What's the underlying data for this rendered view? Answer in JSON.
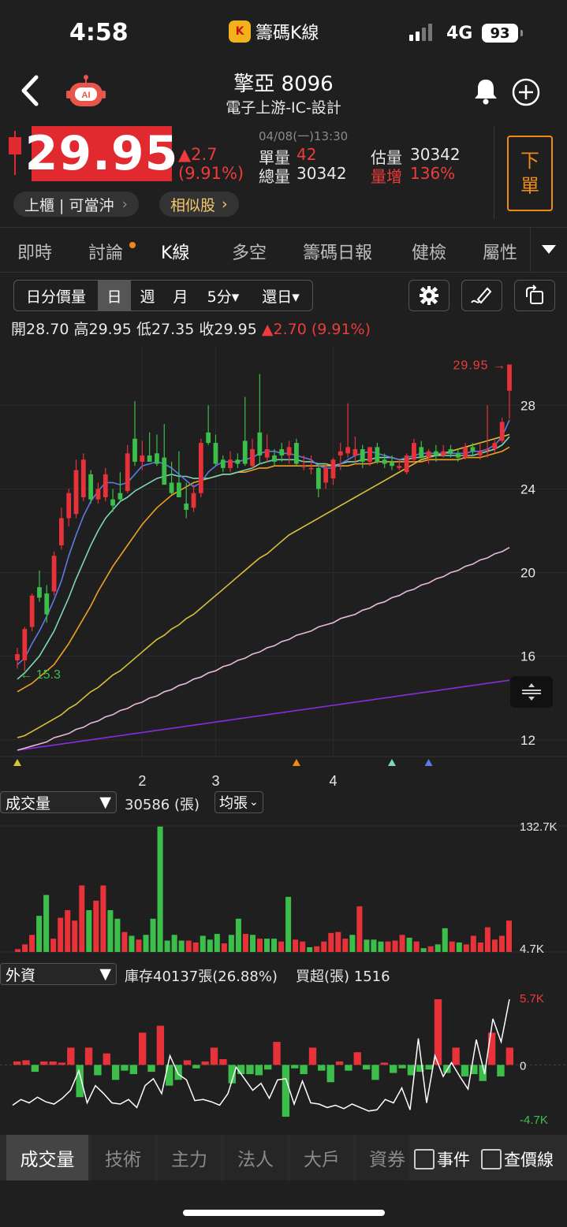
{
  "status": {
    "time": "4:58",
    "app_icon": "K",
    "app_name": "籌碼K線",
    "network": "4G",
    "battery": "93"
  },
  "header": {
    "title": "擎亞 8096",
    "subtitle": "電子上游-IC-設計",
    "ai_badge": "AI"
  },
  "quote": {
    "price": "29.95",
    "change": "▲2.7",
    "change_pct": "(9.91%)",
    "datetime": "04/08(一)13:30",
    "single_vol_label": "單量",
    "single_vol": "42",
    "est_vol_label": "估量",
    "est_vol": "30342",
    "total_vol_label": "總量",
    "total_vol": "30342",
    "vol_inc_label": "量增",
    "vol_inc": "136%",
    "market_tag": "上櫃 | 可當沖",
    "similar": "相似股",
    "sell_button": [
      "下",
      "單"
    ]
  },
  "tabs": [
    "即時",
    "討論",
    "K線",
    "多空",
    "籌碼日報",
    "健檢",
    "屬性"
  ],
  "active_tab": "K線",
  "chart_toolbar": {
    "segments": [
      "日分價量",
      "日",
      "週",
      "月",
      "5分▾",
      "還日▾"
    ],
    "active": "日"
  },
  "ohlc": {
    "open_label": "開",
    "open": "28.70",
    "high_label": "高",
    "high": "29.95",
    "low_label": "低",
    "low": "27.35",
    "close_label": "收",
    "close": "29.95",
    "change": "▲2.70 (9.91%)"
  },
  "colors": {
    "up": "#e8323a",
    "down": "#3cbf4a",
    "ma5": "#5b7be6",
    "ma10": "#7fd6b6",
    "ma20": "#f0a020",
    "ma60": "#d8c23a",
    "ma120": "#eab8dc",
    "ma240": "#8a2be2",
    "accent": "#f08a17"
  },
  "chart_data": [
    {
      "type": "candlestick",
      "y_ticks": [
        "28",
        "24",
        "20",
        "16",
        "12"
      ],
      "ylim": [
        11.2,
        30.8
      ],
      "x_ticks": [
        {
          "label": "2",
          "index": 17
        },
        {
          "label": "3",
          "index": 27
        },
        {
          "label": "4",
          "index": 43
        }
      ],
      "annotations": {
        "high_price": "29.95",
        "low_price": "15.3"
      },
      "candles": [
        {
          "o": 15.8,
          "h": 16.4,
          "l": 15.4,
          "c": 16.1
        },
        {
          "o": 15.8,
          "h": 17.4,
          "l": 15.3,
          "c": 17.3
        },
        {
          "o": 17.4,
          "h": 19.0,
          "l": 17.2,
          "c": 18.9
        },
        {
          "o": 19.3,
          "h": 20.1,
          "l": 18.6,
          "c": 18.8
        },
        {
          "o": 19.0,
          "h": 19.4,
          "l": 17.6,
          "c": 18.0
        },
        {
          "o": 19.1,
          "h": 21.0,
          "l": 18.9,
          "c": 20.8
        },
        {
          "o": 21.3,
          "h": 23.1,
          "l": 21.1,
          "c": 22.6
        },
        {
          "o": 22.6,
          "h": 24.0,
          "l": 22.2,
          "c": 23.8
        },
        {
          "o": 22.8,
          "h": 25.4,
          "l": 22.6,
          "c": 24.9
        },
        {
          "o": 23.6,
          "h": 25.7,
          "l": 23.4,
          "c": 25.4
        },
        {
          "o": 24.7,
          "h": 24.9,
          "l": 23.3,
          "c": 23.5
        },
        {
          "o": 23.5,
          "h": 24.3,
          "l": 23.3,
          "c": 24.0
        },
        {
          "o": 23.6,
          "h": 25.0,
          "l": 23.4,
          "c": 24.7
        },
        {
          "o": 23.5,
          "h": 24.0,
          "l": 22.9,
          "c": 23.2
        },
        {
          "o": 23.8,
          "h": 24.8,
          "l": 23.4,
          "c": 23.5
        },
        {
          "o": 23.9,
          "h": 26.1,
          "l": 23.8,
          "c": 25.7
        },
        {
          "o": 26.4,
          "h": 28.2,
          "l": 25.1,
          "c": 25.3
        },
        {
          "o": 25.3,
          "h": 26.3,
          "l": 24.9,
          "c": 25.6
        },
        {
          "o": 25.6,
          "h": 26.7,
          "l": 25.3,
          "c": 25.3
        },
        {
          "o": 25.7,
          "h": 26.6,
          "l": 25.1,
          "c": 25.2
        },
        {
          "o": 25.5,
          "h": 27.1,
          "l": 24.2,
          "c": 24.2
        },
        {
          "o": 24.3,
          "h": 25.3,
          "l": 23.7,
          "c": 23.8
        },
        {
          "o": 24.3,
          "h": 25.8,
          "l": 23.6,
          "c": 23.6
        },
        {
          "o": 23.3,
          "h": 24.3,
          "l": 22.6,
          "c": 23.0
        },
        {
          "o": 23.1,
          "h": 24.2,
          "l": 22.9,
          "c": 23.8
        },
        {
          "o": 23.8,
          "h": 26.4,
          "l": 23.6,
          "c": 26.2
        },
        {
          "o": 26.7,
          "h": 28.0,
          "l": 26.1,
          "c": 26.2
        },
        {
          "o": 26.2,
          "h": 26.6,
          "l": 25.1,
          "c": 25.2
        },
        {
          "o": 25.4,
          "h": 25.6,
          "l": 24.8,
          "c": 25.0
        },
        {
          "o": 25.0,
          "h": 25.8,
          "l": 24.8,
          "c": 25.4
        },
        {
          "o": 25.4,
          "h": 25.7,
          "l": 25.0,
          "c": 25.2
        },
        {
          "o": 26.3,
          "h": 28.4,
          "l": 25.1,
          "c": 25.2
        },
        {
          "o": 25.1,
          "h": 26.4,
          "l": 25.0,
          "c": 25.9
        },
        {
          "o": 26.7,
          "h": 29.5,
          "l": 25.2,
          "c": 25.6
        },
        {
          "o": 25.5,
          "h": 26.6,
          "l": 25.3,
          "c": 25.9
        },
        {
          "o": 25.6,
          "h": 25.9,
          "l": 25.1,
          "c": 25.3
        },
        {
          "o": 25.9,
          "h": 26.2,
          "l": 25.3,
          "c": 25.6
        },
        {
          "o": 25.6,
          "h": 26.3,
          "l": 25.2,
          "c": 26.0
        },
        {
          "o": 26.2,
          "h": 26.4,
          "l": 25.1,
          "c": 25.2
        },
        {
          "o": 25.1,
          "h": 25.6,
          "l": 24.9,
          "c": 25.1
        },
        {
          "o": 25.0,
          "h": 25.6,
          "l": 24.7,
          "c": 25.0
        },
        {
          "o": 25.0,
          "h": 25.2,
          "l": 23.6,
          "c": 24.0
        },
        {
          "o": 24.3,
          "h": 25.2,
          "l": 24.0,
          "c": 25.0
        },
        {
          "o": 24.5,
          "h": 25.5,
          "l": 24.2,
          "c": 25.4
        },
        {
          "o": 25.6,
          "h": 26.2,
          "l": 24.9,
          "c": 25.8
        },
        {
          "o": 25.7,
          "h": 28.1,
          "l": 25.5,
          "c": 26.0
        },
        {
          "o": 25.6,
          "h": 26.5,
          "l": 25.3,
          "c": 25.9
        },
        {
          "o": 25.9,
          "h": 26.1,
          "l": 25.0,
          "c": 25.3
        },
        {
          "o": 25.3,
          "h": 26.0,
          "l": 25.1,
          "c": 26.0
        },
        {
          "o": 26.0,
          "h": 26.2,
          "l": 25.2,
          "c": 25.3
        },
        {
          "o": 25.4,
          "h": 25.7,
          "l": 25.0,
          "c": 25.2
        },
        {
          "o": 25.3,
          "h": 25.6,
          "l": 24.9,
          "c": 25.1
        },
        {
          "o": 25.0,
          "h": 25.4,
          "l": 24.9,
          "c": 25.1
        },
        {
          "o": 24.8,
          "h": 25.7,
          "l": 24.7,
          "c": 25.6
        },
        {
          "o": 25.4,
          "h": 26.4,
          "l": 25.2,
          "c": 26.2
        },
        {
          "o": 26.0,
          "h": 26.3,
          "l": 25.5,
          "c": 25.5
        },
        {
          "o": 25.5,
          "h": 25.9,
          "l": 25.2,
          "c": 25.8
        },
        {
          "o": 25.8,
          "h": 26.1,
          "l": 25.3,
          "c": 25.6
        },
        {
          "o": 25.6,
          "h": 26.1,
          "l": 25.5,
          "c": 25.8
        },
        {
          "o": 25.9,
          "h": 26.1,
          "l": 25.5,
          "c": 25.7
        },
        {
          "o": 25.7,
          "h": 25.9,
          "l": 25.3,
          "c": 25.5
        },
        {
          "o": 25.5,
          "h": 26.2,
          "l": 25.4,
          "c": 26.0
        },
        {
          "o": 26.0,
          "h": 26.2,
          "l": 25.6,
          "c": 25.8
        },
        {
          "o": 25.6,
          "h": 26.2,
          "l": 25.4,
          "c": 25.8
        },
        {
          "o": 25.9,
          "h": 28.0,
          "l": 25.5,
          "c": 25.9
        },
        {
          "o": 25.9,
          "h": 26.4,
          "l": 25.7,
          "c": 26.2
        },
        {
          "o": 26.3,
          "h": 27.4,
          "l": 26.2,
          "c": 27.2
        },
        {
          "o": 28.7,
          "h": 29.95,
          "l": 27.35,
          "c": 29.95
        }
      ],
      "ma": {
        "ma5": [
          15.6,
          15.9,
          16.6,
          17.2,
          17.9,
          18.7,
          19.6,
          20.8,
          21.8,
          22.7,
          23.4,
          23.9,
          24.3,
          24.3,
          24.2,
          24.3,
          24.7,
          25.1,
          25.2,
          25.3,
          25.2,
          25.0,
          24.7,
          24.4,
          24.1,
          24.3,
          24.8,
          25.1,
          25.3,
          25.3,
          25.3,
          25.4,
          25.5,
          25.7,
          25.8,
          25.8,
          25.7,
          25.7,
          25.6,
          25.5,
          25.4,
          25.1,
          25.0,
          25.0,
          25.2,
          25.4,
          25.6,
          25.7,
          25.8,
          25.7,
          25.6,
          25.5,
          25.4,
          25.5,
          25.6,
          25.7,
          25.7,
          25.7,
          25.7,
          25.7,
          25.7,
          25.7,
          25.8,
          25.8,
          25.9,
          26.1,
          26.5,
          27.3
        ],
        "ma10": [
          14.9,
          15.2,
          15.6,
          16.0,
          16.6,
          17.2,
          18.0,
          18.8,
          19.7,
          20.5,
          21.3,
          22.0,
          22.6,
          23.0,
          23.4,
          23.6,
          23.9,
          24.1,
          24.3,
          24.5,
          24.6,
          24.7,
          24.6,
          24.6,
          24.5,
          24.5,
          24.5,
          24.6,
          24.7,
          24.7,
          24.8,
          24.9,
          25.0,
          25.2,
          25.3,
          25.4,
          25.4,
          25.4,
          25.4,
          25.3,
          25.3,
          25.2,
          25.2,
          25.1,
          25.2,
          25.3,
          25.3,
          25.4,
          25.4,
          25.5,
          25.5,
          25.5,
          25.4,
          25.4,
          25.5,
          25.5,
          25.6,
          25.6,
          25.6,
          25.6,
          25.6,
          25.6,
          25.6,
          25.7,
          25.8,
          25.9,
          26.1,
          26.5
        ],
        "ma20": [
          14.3,
          14.5,
          14.7,
          15.0,
          15.3,
          15.6,
          16.1,
          16.6,
          17.2,
          17.8,
          18.4,
          19.1,
          19.7,
          20.3,
          20.8,
          21.3,
          21.8,
          22.3,
          22.7,
          23.1,
          23.4,
          23.7,
          23.9,
          24.1,
          24.3,
          24.4,
          24.5,
          24.6,
          24.7,
          24.7,
          24.8,
          24.8,
          24.9,
          25.0,
          25.0,
          25.1,
          25.1,
          25.1,
          25.1,
          25.1,
          25.1,
          25.1,
          25.1,
          25.1,
          25.1,
          25.1,
          25.2,
          25.2,
          25.2,
          25.3,
          25.3,
          25.3,
          25.3,
          25.3,
          25.3,
          25.3,
          25.4,
          25.4,
          25.4,
          25.4,
          25.4,
          25.5,
          25.5,
          25.5,
          25.6,
          25.7,
          25.8,
          26.0
        ],
        "ma60": [
          12.1,
          12.2,
          12.4,
          12.6,
          12.8,
          13.0,
          13.2,
          13.5,
          13.7,
          14.0,
          14.3,
          14.5,
          14.8,
          15.1,
          15.3,
          15.6,
          15.9,
          16.2,
          16.5,
          16.8,
          17.0,
          17.3,
          17.5,
          17.8,
          18.0,
          18.3,
          18.6,
          18.9,
          19.2,
          19.5,
          19.8,
          20.1,
          20.4,
          20.7,
          20.9,
          21.2,
          21.5,
          21.8,
          22.0,
          22.2,
          22.4,
          22.6,
          22.8,
          23.0,
          23.2,
          23.4,
          23.6,
          23.8,
          24.0,
          24.2,
          24.4,
          24.6,
          24.8,
          25.0,
          25.2,
          25.4,
          25.5,
          25.6,
          25.7,
          25.8,
          25.9,
          26.0,
          26.1,
          26.2,
          26.3,
          26.4,
          26.5,
          26.6
        ],
        "ma120": [
          11.5,
          11.6,
          11.7,
          11.8,
          11.9,
          12.1,
          12.2,
          12.3,
          12.5,
          12.6,
          12.8,
          12.9,
          13.1,
          13.2,
          13.4,
          13.5,
          13.7,
          13.8,
          14.0,
          14.1,
          14.3,
          14.4,
          14.6,
          14.7,
          14.9,
          15.0,
          15.2,
          15.3,
          15.5,
          15.6,
          15.8,
          15.9,
          16.1,
          16.2,
          16.4,
          16.5,
          16.7,
          16.8,
          17.0,
          17.1,
          17.2,
          17.4,
          17.5,
          17.6,
          17.8,
          17.9,
          18.0,
          18.2,
          18.3,
          18.5,
          18.6,
          18.8,
          18.9,
          19.1,
          19.2,
          19.4,
          19.5,
          19.7,
          19.8,
          20.0,
          20.1,
          20.3,
          20.4,
          20.6,
          20.7,
          20.9,
          21.0,
          21.2
        ],
        "ma240": [
          11.5,
          11.55,
          11.6,
          11.65,
          11.7,
          11.75,
          11.8,
          11.85,
          11.9,
          11.95,
          12.0,
          12.05,
          12.1,
          12.15,
          12.2,
          12.25,
          12.3,
          12.35,
          12.4,
          12.45,
          12.5,
          12.55,
          12.6,
          12.65,
          12.7,
          12.75,
          12.8,
          12.85,
          12.9,
          12.95,
          13.0,
          13.05,
          13.1,
          13.15,
          13.2,
          13.25,
          13.3,
          13.35,
          13.4,
          13.45,
          13.5,
          13.55,
          13.6,
          13.65,
          13.7,
          13.75,
          13.8,
          13.85,
          13.9,
          13.95,
          14.0,
          14.05,
          14.1,
          14.15,
          14.2,
          14.25,
          14.3,
          14.35,
          14.4,
          14.45,
          14.5,
          14.55,
          14.6,
          14.65,
          14.7,
          14.75,
          14.8,
          14.85
        ]
      }
    },
    {
      "type": "bar",
      "title": "成交量",
      "value_label": "30586 (張)",
      "unit_option": "均張",
      "ylim": [
        0,
        132.7
      ],
      "y_ticks": [
        "132.7K",
        "4.7K"
      ],
      "values_k": [
        3,
        8,
        18,
        38,
        60,
        14,
        36,
        44,
        33,
        70,
        44,
        54,
        70,
        44,
        35,
        21,
        17,
        13,
        18,
        35,
        132,
        12,
        18,
        12,
        12,
        10,
        17,
        13,
        19,
        9,
        18,
        35,
        19,
        18,
        14,
        14,
        14,
        11,
        58,
        13,
        11,
        5,
        6,
        11,
        20,
        21,
        14,
        18,
        48,
        13,
        13,
        11,
        11,
        12,
        18,
        15,
        11,
        4,
        6,
        8,
        25,
        11,
        10,
        8,
        17,
        10,
        26,
        13,
        17,
        33
      ]
    },
    {
      "type": "bar",
      "title": "外資",
      "stock": "庫存40137張(26.88%)",
      "net_buy": "買超(張) 1516",
      "ylim": [
        -4.7,
        5.7
      ],
      "y_ticks": [
        "5.7K",
        "0",
        "-4.7K"
      ],
      "values_k": [
        0.3,
        0.4,
        -0.6,
        0.3,
        0.3,
        0.2,
        1.5,
        -2.8,
        1.5,
        -0.9,
        1.0,
        -1.3,
        -0.5,
        -0.8,
        2.8,
        -0.6,
        3.4,
        -1.8,
        -1.3,
        0.4,
        -0.3,
        0.3,
        1.5,
        0.5,
        -1.6,
        -0.8,
        -0.8,
        -0.9,
        -0.4,
        2.0,
        -4.5,
        -0.3,
        -0.8,
        1.5,
        -0.5,
        -1.5,
        0.3,
        -0.5,
        1.1,
        -0.4,
        -1.3,
        0.2,
        -0.7,
        -0.3,
        -0.9,
        -0.6,
        -0.4,
        5.7,
        -0.7,
        1.5,
        -1.0,
        -0.8,
        -1.4,
        2.8,
        -1.0,
        1.5
      ]
    }
  ],
  "foreign_line": [
    -3.5,
    -3.0,
    -3.3,
    -2.8,
    -3.2,
    -3.4,
    -2.9,
    -2.2,
    -0.5,
    -3.3,
    -1.8,
    -2.5,
    -3.3,
    -3.4,
    -3.0,
    -3.7,
    -1.8,
    -1.2,
    -2.5,
    0.8,
    -0.8,
    -1.3,
    -3.1,
    -3.0,
    -3.2,
    -3.5,
    -2.5,
    -0.2,
    -1.2,
    -2.2,
    -1.6,
    -2.9,
    -1.3,
    -1.2,
    -3.4,
    -1.4,
    -3.3,
    -3.4,
    -3.7,
    -3.5,
    -3.8,
    -3.4,
    -3.7,
    -4.0,
    -3.9,
    -3.0,
    -3.3,
    -2.0,
    -3.9,
    2.3,
    -3.3,
    0.8,
    -1.0,
    0.2,
    -1.0,
    -2.1,
    2.2,
    -0.8,
    4.0,
    2.0,
    5.7
  ],
  "volume_panel": {
    "selector": "成交量",
    "value": "30586 (張)",
    "unit": "均張"
  },
  "foreign_panel": {
    "selector": "外資",
    "stock": "庫存40137張(26.88%)",
    "net": "買超(張) 1516"
  },
  "bottom_tabs": [
    "成交量",
    "技術",
    "主力",
    "法人",
    "大戶",
    "資券"
  ],
  "bottom_active": "成交量",
  "checkboxes": [
    "事件",
    "查價線"
  ]
}
